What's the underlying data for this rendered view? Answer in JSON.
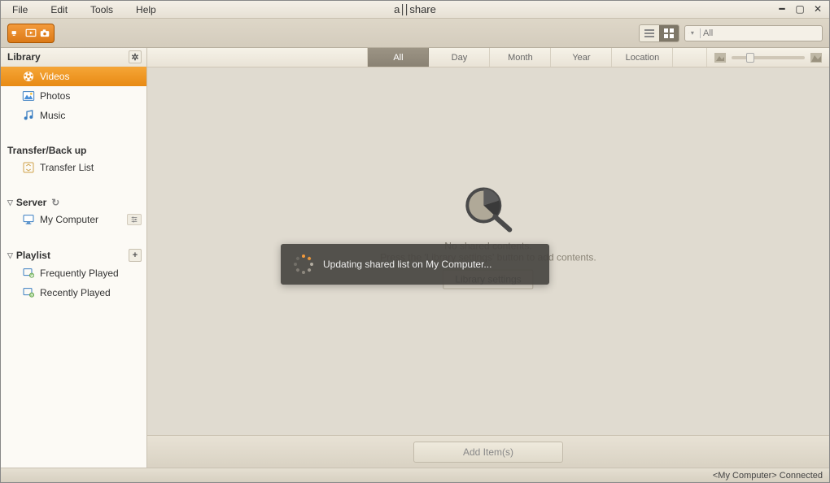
{
  "app_title_parts": {
    "left": "a",
    "right": "share"
  },
  "menus": [
    "File",
    "Edit",
    "Tools",
    "Help"
  ],
  "search": {
    "placeholder": "All"
  },
  "sidebar": {
    "library_label": "Library",
    "items": [
      {
        "label": "Videos",
        "icon": "film"
      },
      {
        "label": "Photos",
        "icon": "photo"
      },
      {
        "label": "Music",
        "icon": "music"
      }
    ],
    "transfer_label": "Transfer/Back up",
    "transfer_item": "Transfer List",
    "server_label": "Server",
    "server_item": "My Computer",
    "playlist_label": "Playlist",
    "playlist_items": [
      "Frequently Played",
      "Recently Played"
    ]
  },
  "filters": [
    "All",
    "Day",
    "Month",
    "Year",
    "Location"
  ],
  "empty": {
    "line1": "No shared contents.",
    "line2": "Press the 'Library settings' button to add contents.",
    "button": "Library settings"
  },
  "bottom_button": "Add Item(s)",
  "toast": "Updating shared list on My Computer...",
  "status": "<My Computer>  Connected"
}
